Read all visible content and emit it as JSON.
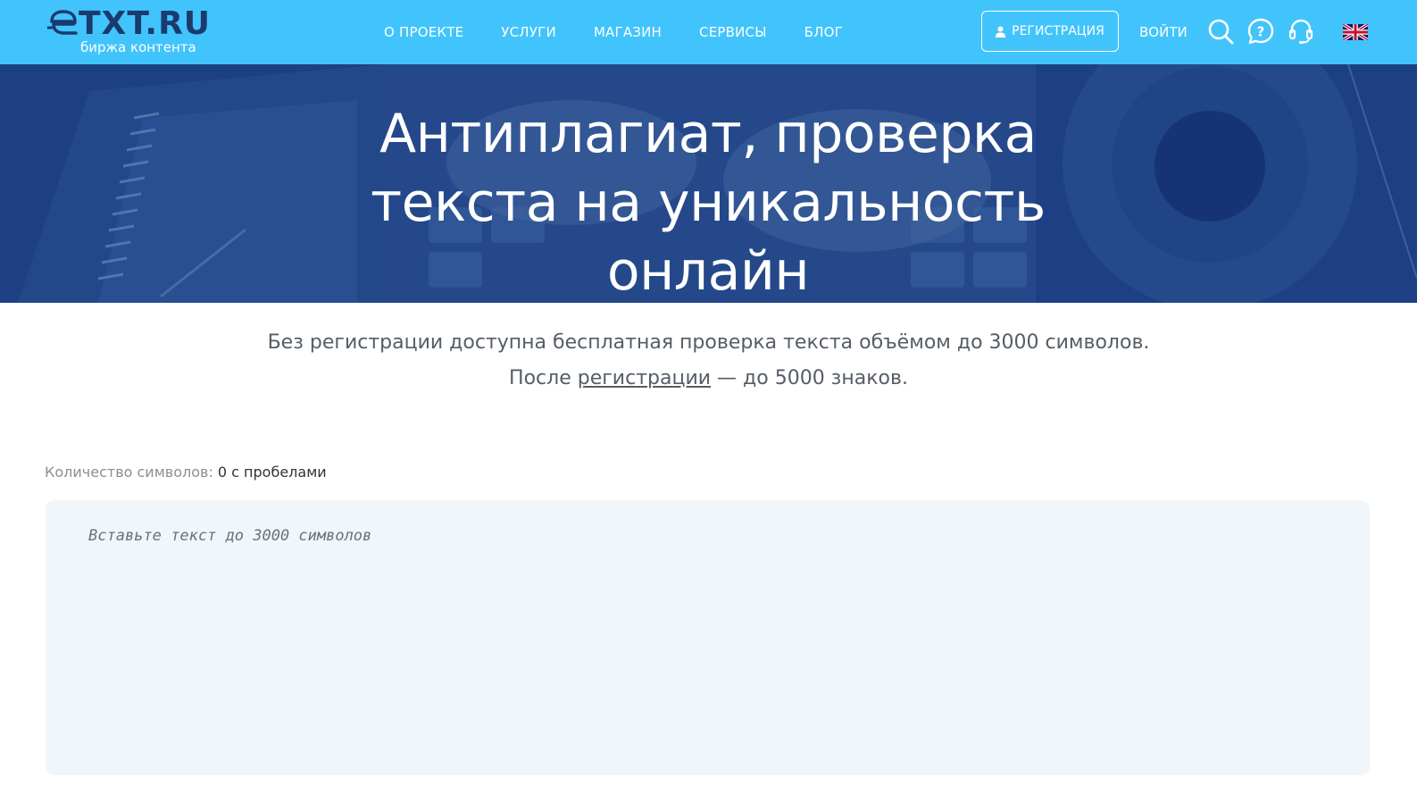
{
  "header": {
    "logo_text": "TXT.RU",
    "logo_subtitle": "биржа контента",
    "nav": [
      {
        "label": "О ПРОЕКТЕ"
      },
      {
        "label": "УСЛУГИ"
      },
      {
        "label": "МАГАЗИН"
      },
      {
        "label": "СЕРВИСЫ"
      },
      {
        "label": "БЛОГ"
      }
    ],
    "register_label": "РЕГИСТРАЦИЯ",
    "login_label": "ВОЙТИ",
    "icons": [
      "search-icon",
      "help-icon",
      "support-headset-icon",
      "uk-flag-icon"
    ],
    "colors": {
      "header_bg": "#41c4fb",
      "hero_bg": "#1d3f84",
      "logo": "#1b3a6e"
    }
  },
  "hero": {
    "title_line1": "Антиплагиат, проверка",
    "title_line2": "текста на уникальность",
    "title_line3": "онлайн"
  },
  "intro": {
    "line1": "Без регистрации доступна бесплатная проверка текста объёмом до 3000 символов.",
    "line2_before": "После ",
    "line2_link": "регистрации",
    "line2_after": " — до 5000 знаков."
  },
  "counter": {
    "label": "Количество символов: ",
    "value": "0 с пробелами"
  },
  "editor": {
    "placeholder": "Вставьте текст до 3000 символов",
    "value": ""
  }
}
